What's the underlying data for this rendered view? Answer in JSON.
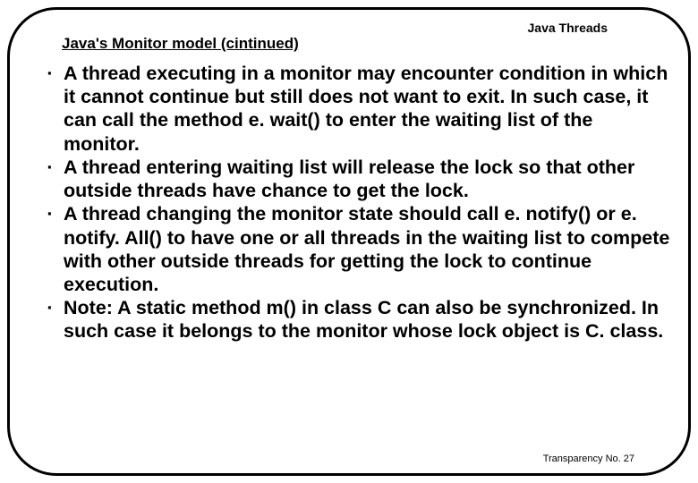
{
  "header": {
    "topic": "Java Threads",
    "title": "Java's Monitor model (cintinued)"
  },
  "bullets": [
    "A thread executing in a monitor may encounter condition in which it cannot continue but still does not want to exit. In such case, it can call the method e. wait() to enter the waiting list of the monitor.",
    "A thread entering waiting list will release the lock so that other outside threads have chance to get the lock.",
    "A thread changing the monitor state should call e. notify() or e. notify. All() to have one or all threads in the waiting list to compete with other outside threads for getting the lock to continue execution.",
    "Note: A static method m() in class C can also be synchronized. In such case it belongs to the monitor whose lock object is C. class."
  ],
  "footer": {
    "page_label": "Transparency No. 27"
  },
  "marker": "·"
}
